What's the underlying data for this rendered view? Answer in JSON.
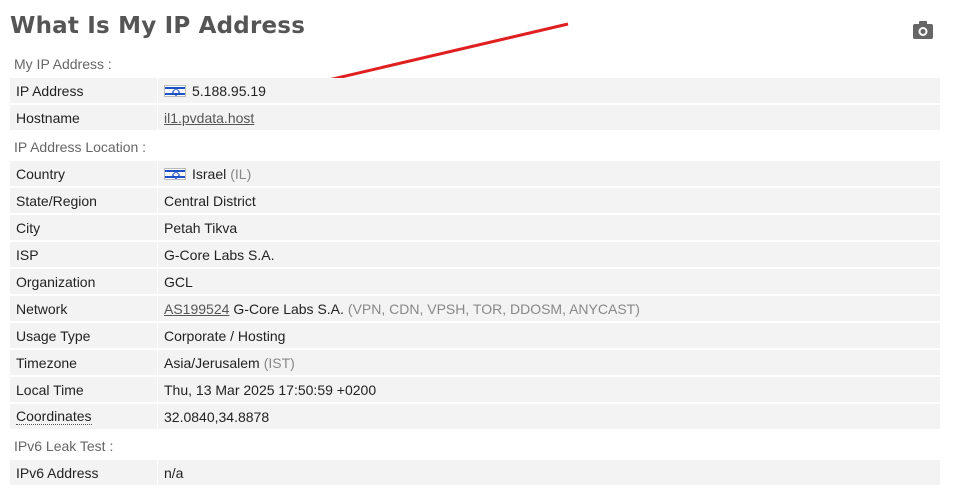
{
  "title": "What Is My IP Address",
  "sections": {
    "my_ip": "My IP Address :",
    "location": "IP Address Location :",
    "ipv6": "IPv6 Leak Test :"
  },
  "rows": {
    "ip_address": {
      "label": "IP Address",
      "value": "5.188.95.19"
    },
    "hostname": {
      "label": "Hostname",
      "value": "il1.pvdata.host"
    },
    "country": {
      "label": "Country",
      "value": "Israel",
      "extra": "(IL)"
    },
    "state": {
      "label": "State/Region",
      "value": "Central District"
    },
    "city": {
      "label": "City",
      "value": "Petah Tikva"
    },
    "isp": {
      "label": "ISP",
      "value": "G-Core Labs S.A."
    },
    "organization": {
      "label": "Organization",
      "value": "GCL"
    },
    "network": {
      "label": "Network",
      "link": "AS199524",
      "value": "G-Core Labs S.A.",
      "extra": "(VPN, CDN, VPSH, TOR, DDOSM, ANYCAST)"
    },
    "usage_type": {
      "label": "Usage Type",
      "value": "Corporate / Hosting"
    },
    "timezone": {
      "label": "Timezone",
      "value": "Asia/Jerusalem",
      "extra": "(IST)"
    },
    "local_time": {
      "label": "Local Time",
      "value": "Thu, 13 Mar 2025 17:50:59 +0200"
    },
    "coordinates": {
      "label": "Coordinates",
      "value": "32.0840,34.8878"
    },
    "ipv6_address": {
      "label": "IPv6 Address",
      "value": "n/a"
    }
  },
  "icons": {
    "camera": "camera-icon",
    "flag": "israel-flag-icon"
  },
  "colors": {
    "arrow": "#e02020",
    "row_bg": "#f3f3f3"
  }
}
